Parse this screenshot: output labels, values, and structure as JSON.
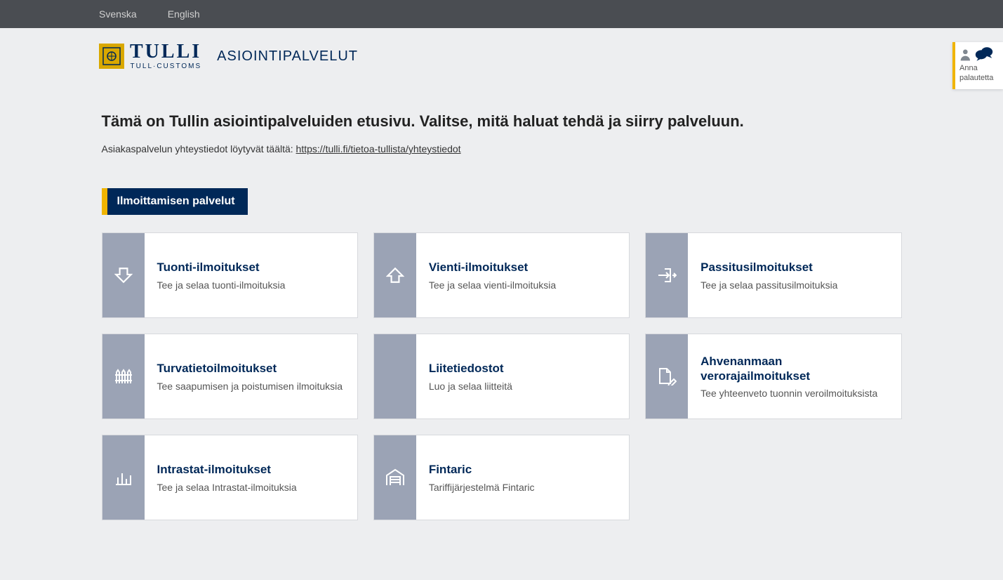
{
  "topbar": {
    "lang_sv": "Svenska",
    "lang_en": "English"
  },
  "header": {
    "logo_main": "TULLI",
    "logo_sub": "TULL·CUSTOMS",
    "site_title": "ASIOINTIPALVELUT"
  },
  "feedback": {
    "line1": "Anna",
    "line2": "palautetta"
  },
  "intro": {
    "heading": "Tämä on Tullin asiointipalveluiden etusivu. Valitse, mitä haluat tehdä ja siirry palveluun.",
    "contact_prefix": "Asiakaspalvelun yhteystiedot löytyvät täältä: ",
    "contact_link": "https://tulli.fi/tietoa-tullista/yhteystiedot"
  },
  "section": {
    "title": "Ilmoittamisen palvelut"
  },
  "cards": [
    {
      "icon": "arrow-down",
      "title": "Tuonti-ilmoitukset",
      "desc": "Tee ja selaa tuonti-ilmoituksia"
    },
    {
      "icon": "arrow-up",
      "title": "Vienti-ilmoitukset",
      "desc": "Tee ja selaa vienti-ilmoituksia"
    },
    {
      "icon": "enter-right",
      "title": "Passitusilmoitukset",
      "desc": "Tee ja selaa passitusilmoituksia"
    },
    {
      "icon": "fence",
      "title": "Turvatietoilmoitukset",
      "desc": "Tee saapumisen ja poistumisen ilmoituksia"
    },
    {
      "icon": "blank",
      "title": "Liitetiedostot",
      "desc": "Luo ja selaa liitteitä"
    },
    {
      "icon": "file-pen",
      "title": "Ahvenanmaan verorajailmoitukset",
      "desc": "Tee yhteenveto tuonnin veroilmoituksista"
    },
    {
      "icon": "bar-chart",
      "title": "Intrastat-ilmoitukset",
      "desc": "Tee ja selaa Intrastat-ilmoituksia"
    },
    {
      "icon": "warehouse",
      "title": "Fintaric",
      "desc": "Tariffijärjestelmä Fintaric"
    }
  ]
}
